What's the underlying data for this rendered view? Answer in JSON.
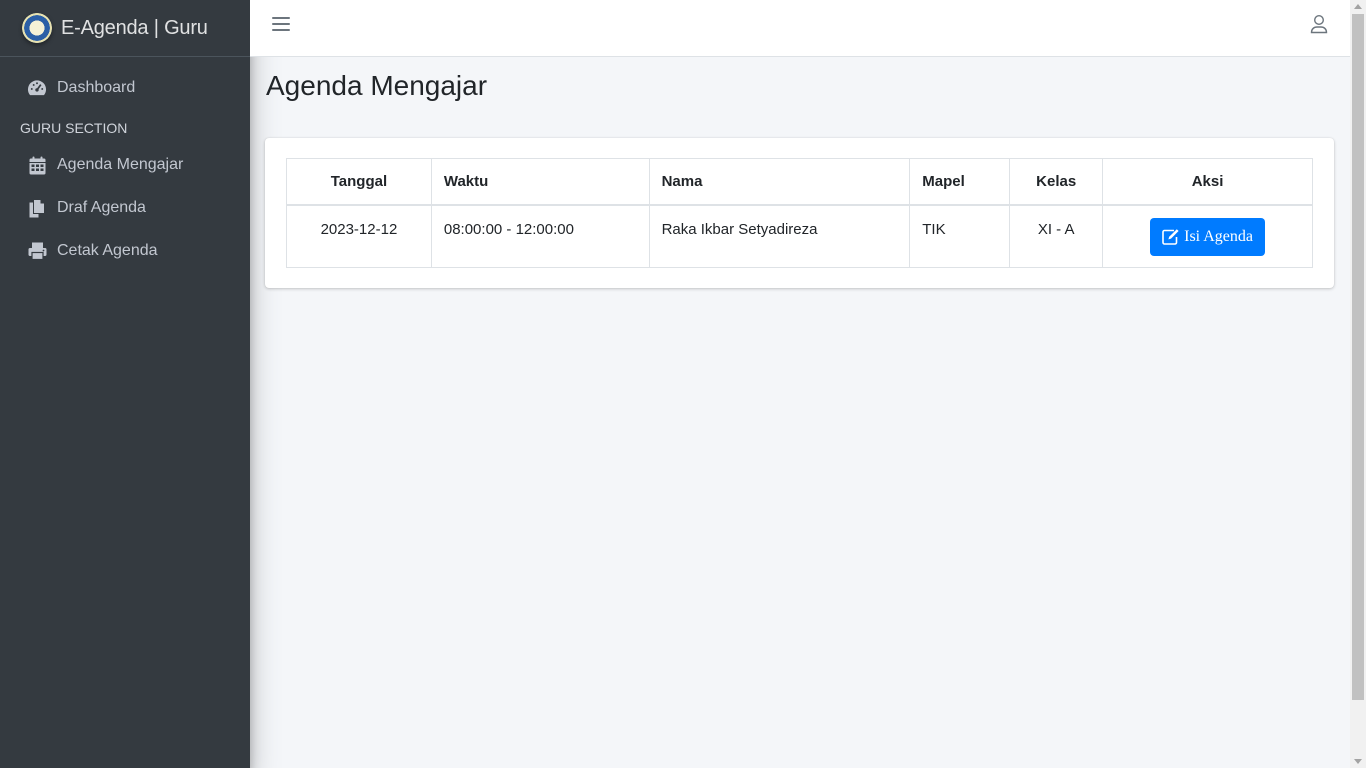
{
  "brand": {
    "title": "E-Agenda | Guru"
  },
  "sidebar": {
    "dashboard": "Dashboard",
    "section_header": "GURU SECTION",
    "items": [
      {
        "label": "Agenda Mengajar",
        "icon": "calendar-icon"
      },
      {
        "label": "Draf Agenda",
        "icon": "copy-icon"
      },
      {
        "label": "Cetak Agenda",
        "icon": "print-icon"
      }
    ]
  },
  "page": {
    "title": "Agenda Mengajar"
  },
  "table": {
    "headers": [
      "Tanggal",
      "Waktu",
      "Nama",
      "Mapel",
      "Kelas",
      "Aksi"
    ],
    "rows": [
      {
        "tanggal": "2023-12-12",
        "waktu": "08:00:00 - 12:00:00",
        "nama": "Raka Ikbar Setyadireza",
        "mapel": "TIK",
        "kelas": "XI - A",
        "aksi": "Isi Agenda"
      }
    ]
  },
  "colors": {
    "sidebar_bg": "#343a40",
    "primary": "#007bff",
    "content_bg": "#f4f6f9"
  }
}
